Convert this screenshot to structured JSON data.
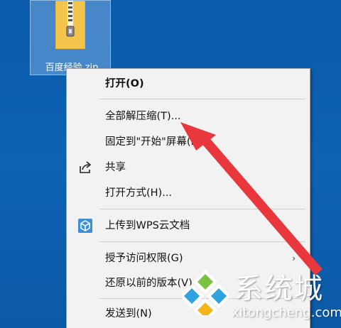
{
  "desktop": {
    "background_color": "#0c5fae",
    "file": {
      "label": "百度经验.zip",
      "icon": "zip-folder-icon"
    }
  },
  "context_menu": {
    "items": [
      {
        "label": "打开(O)",
        "bold": true
      },
      {
        "label": "全部解压缩(T)..."
      },
      {
        "label": "固定到\"开始\"屏幕(P)"
      },
      {
        "label": "共享",
        "icon": "share-icon"
      },
      {
        "label": "打开方式(H)..."
      },
      {
        "label": "上传到WPS云文档",
        "icon": "wps-cloud-icon"
      },
      {
        "label": "授予访问权限(G)",
        "submenu_arrow": "›"
      },
      {
        "label": "还原以前的版本(V)"
      },
      {
        "label": "发送到(N)"
      }
    ]
  },
  "annotation": {
    "arrow_color": "#e8383d",
    "arrow_icon": "red-pointer-arrow"
  },
  "watermark": {
    "brand_text": "系统城",
    "url": "xitongcheng.com",
    "logo_icon": "windows-diamond-logo-icon"
  }
}
